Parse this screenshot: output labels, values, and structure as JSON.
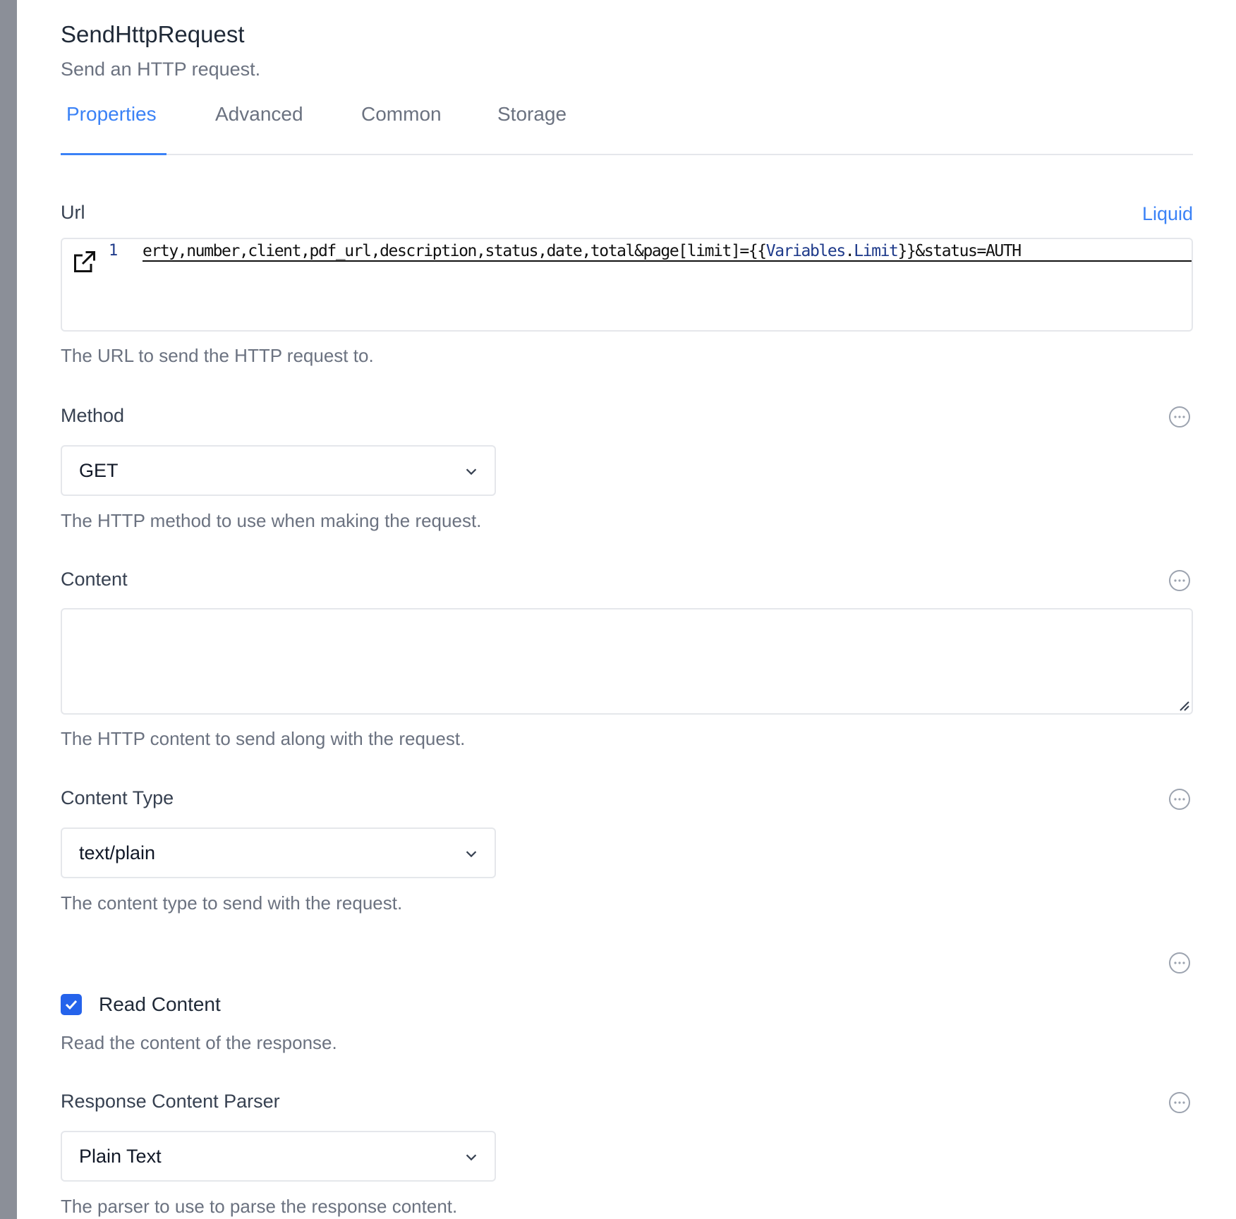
{
  "header": {
    "title": "SendHttpRequest",
    "subtitle": "Send an HTTP request."
  },
  "tabs": [
    {
      "label": "Properties",
      "active": true
    },
    {
      "label": "Advanced"
    },
    {
      "label": "Common"
    },
    {
      "label": "Storage"
    }
  ],
  "accent_color": "#3b82f6",
  "url": {
    "label": "Url",
    "syntax": "Liquid",
    "line_number": "1",
    "code_before": "erty,number,client,pdf_url,description,status,date,total&page[limit]={{",
    "code_var1": "Variables",
    "code_dot": ".",
    "code_var2": "Limit",
    "code_after": "}}&status=AUTH",
    "help": "The URL to send the HTTP request to."
  },
  "method": {
    "label": "Method",
    "value": "GET",
    "help": "The HTTP method to use when making the request."
  },
  "content": {
    "label": "Content",
    "value": "",
    "help": "The HTTP content to send along with the request."
  },
  "content_type": {
    "label": "Content Type",
    "value": "text/plain",
    "help": "The content type to send with the request."
  },
  "read_content": {
    "label": "Read Content",
    "checked": true,
    "help": "Read the content of the response."
  },
  "response_parser": {
    "label": "Response Content Parser",
    "value": "Plain Text",
    "help": "The parser to use to parse the response content."
  }
}
